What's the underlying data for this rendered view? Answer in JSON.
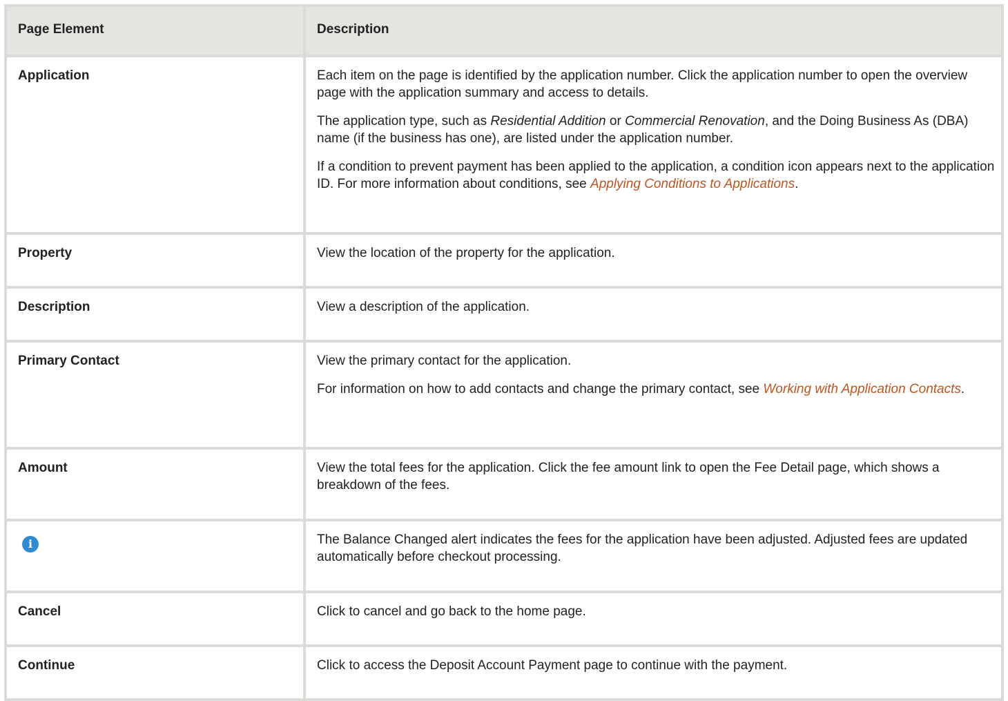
{
  "table": {
    "headers": [
      "Page Element",
      "Description"
    ],
    "rows": {
      "application": {
        "element": "Application",
        "p1": "Each item on the page is identified by the application number. Click the application number to open the overview page with the application summary and access to details.",
        "p2_before": "The application type, such as ",
        "p2_em1": "Residential Addition",
        "p2_mid": " or ",
        "p2_em2": "Commercial Renovation",
        "p2_after": ", and the Doing Business As (DBA) name (if the business has one), are listed under the application number.",
        "p3_before": "If a condition to prevent payment has been applied to the application, a condition icon appears next to the application ID. For more information about conditions, see ",
        "p3_link": "Applying Conditions to Applications",
        "p3_after": "."
      },
      "property": {
        "element": "Property",
        "description": "View the location of the property for the application."
      },
      "description": {
        "element": "Description",
        "description": "View a description of the application."
      },
      "primary_contact": {
        "element": "Primary Contact",
        "p1": "View the primary contact for the application.",
        "p2_before": "For information on how to add contacts and change the primary contact, see ",
        "p2_link": "Working with Application Contacts",
        "p2_after": "."
      },
      "amount": {
        "element": "Amount",
        "description": "View the total fees for the application. Click the fee amount link to open the Fee Detail page, which shows a breakdown of the fees."
      },
      "balance_alert": {
        "icon": "info-icon",
        "icon_glyph": "i",
        "description": "The Balance Changed alert indicates the fees for the application have been adjusted. Adjusted fees are updated automatically before checkout processing."
      },
      "cancel": {
        "element": "Cancel",
        "description": "Click to cancel and go back to the home page."
      },
      "continue": {
        "element": "Continue",
        "description": "Click to access the Deposit Account Payment page to continue with the payment."
      }
    }
  },
  "colors": {
    "header_bg": "#e6e4e0",
    "border": "#dcdad6",
    "link": "#c0541e",
    "info_icon": "#2f8ad4"
  }
}
